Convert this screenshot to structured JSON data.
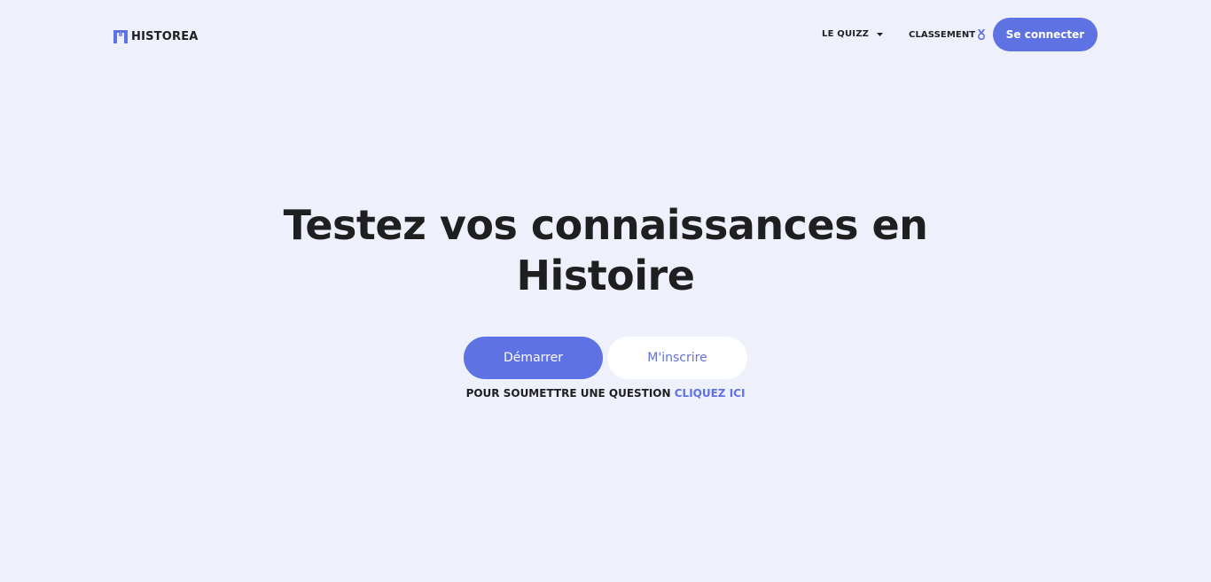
{
  "colors": {
    "background": "#eef0fb",
    "accent": "#5f72e4",
    "text": "#1f1f22",
    "button_secondary_bg": "#ffffff",
    "button_secondary_text": "#6272d6"
  },
  "header": {
    "brand": {
      "icon": "temple-gate-icon",
      "name": "HISTOREA"
    },
    "nav": {
      "quizz": {
        "label": "LE QUIZZ",
        "icon": "caret-down-icon"
      },
      "classement": {
        "label": "CLASSEMENT",
        "icon": "medal-icon"
      }
    },
    "login_label": "Se connecter"
  },
  "hero": {
    "title_line1": "Testez vos connaissances en",
    "title_line2": "Histoire",
    "start_label": "Démarrer",
    "signup_label": "M'inscrire",
    "submit_text": "POUR SOUMETTRE UNE QUESTION",
    "submit_link": "CLIQUEZ ICI"
  }
}
